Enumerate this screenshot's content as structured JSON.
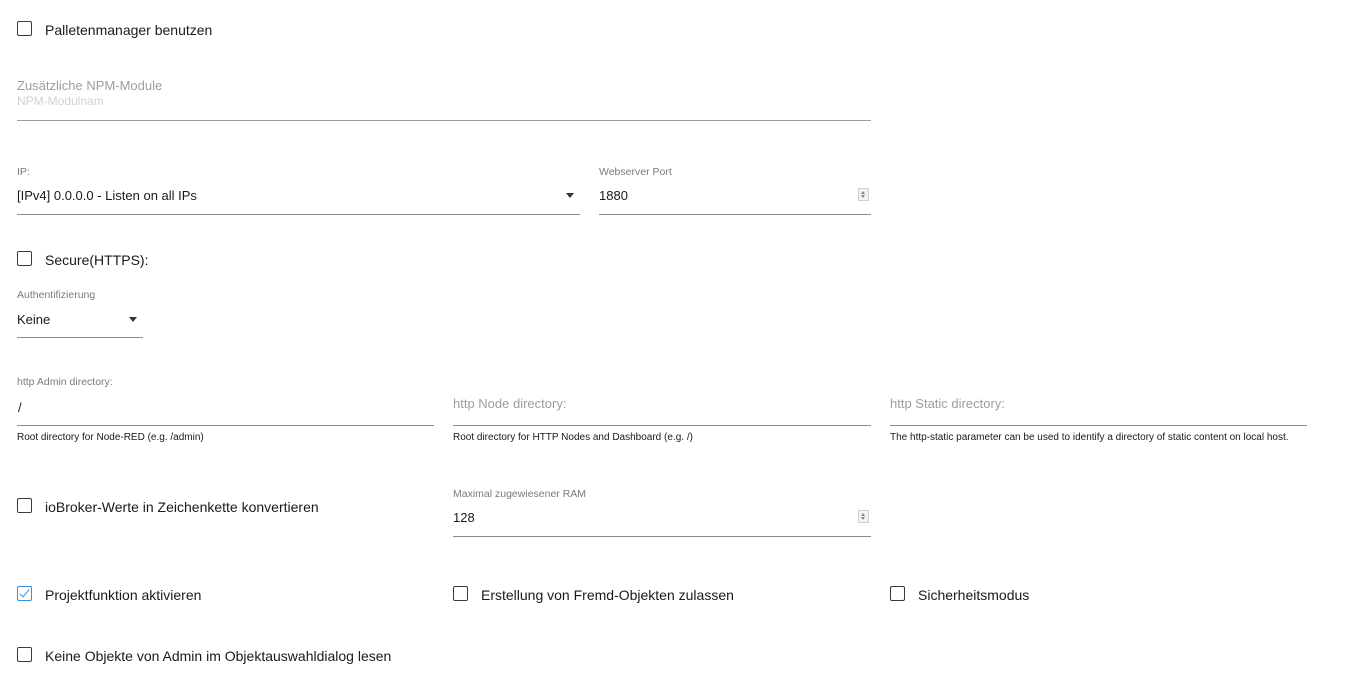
{
  "palette_manager": {
    "label": "Palletenmanager benutzen",
    "checked": false
  },
  "npm_modules": {
    "label": "Zusätzliche NPM-Module",
    "placeholder": "NPM-Modulnam",
    "value": ""
  },
  "ip": {
    "label": "IP:",
    "value": "[IPv4] 0.0.0.0 - Listen on all IPs"
  },
  "webserver_port": {
    "label": "Webserver Port",
    "value": "1880"
  },
  "secure": {
    "label": "Secure(HTTPS):",
    "checked": false
  },
  "auth": {
    "label": "Authentifizierung",
    "value": "Keine"
  },
  "http_admin": {
    "label": "http Admin directory:",
    "value": "/",
    "helper": "Root directory for Node-RED (e.g. /admin)"
  },
  "http_node": {
    "label": "http Node directory:",
    "value": "",
    "helper": "Root directory for HTTP Nodes and Dashboard (e.g. /)"
  },
  "http_static": {
    "label": "http Static directory:",
    "value": "",
    "helper": "The http-static parameter can be used to identify a directory of static content on local host."
  },
  "convert_strings": {
    "label": "ioBroker-Werte in Zeichenkette konvertieren",
    "checked": false
  },
  "max_ram": {
    "label": "Maximal zugewiesener RAM",
    "value": "128"
  },
  "projects": {
    "label": "Projektfunktion aktivieren",
    "checked": true
  },
  "foreign_objects": {
    "label": "Erstellung von Fremd-Objekten zulassen",
    "checked": false
  },
  "safe_mode": {
    "label": "Sicherheitsmodus",
    "checked": false
  },
  "no_admin_objects": {
    "label": "Keine Objekte von Admin im Objektauswahldialog lesen",
    "checked": false
  },
  "colors": {
    "accent": "#3a8fd9",
    "underline": "#8a8a8a",
    "muted_label": "#9e9e9e"
  }
}
